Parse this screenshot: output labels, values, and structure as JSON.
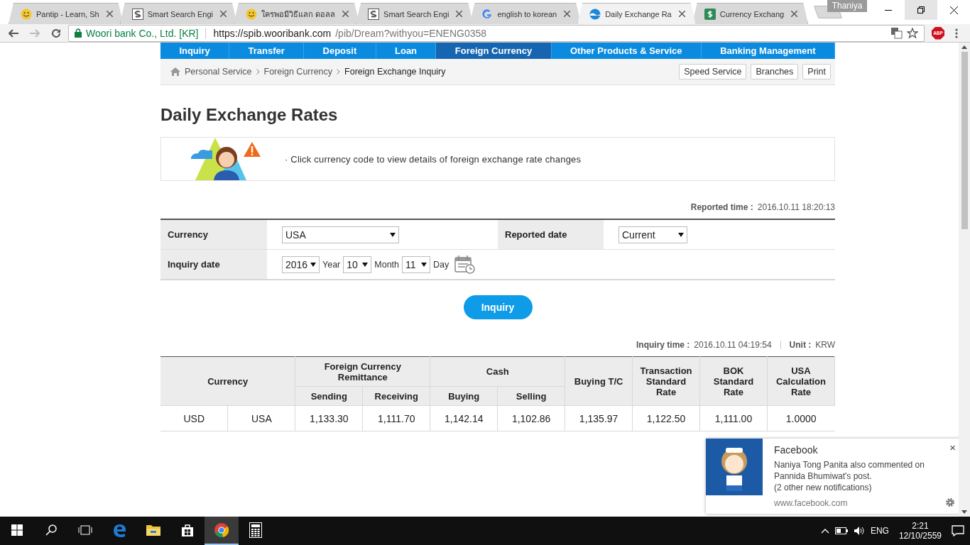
{
  "browser": {
    "tabs": [
      {
        "title": "Pantip - Learn, Sh",
        "kind": "smiley",
        "selected": false
      },
      {
        "title": "Smart Search Engi",
        "kind": "s-logo",
        "selected": false
      },
      {
        "title": "ใครพอมีวิธีแลก ดอลล",
        "kind": "smiley",
        "selected": false
      },
      {
        "title": "Smart Search Engi",
        "kind": "s-logo",
        "selected": false
      },
      {
        "title": "english to korean",
        "kind": "google",
        "selected": false
      },
      {
        "title": "Daily Exchange Ra",
        "kind": "wave",
        "selected": true
      },
      {
        "title": "Currency Exchang",
        "kind": "dollar",
        "selected": false
      }
    ],
    "profile": "Thaniya",
    "site_identity": "Woori bank Co., Ltd. [KR]",
    "url_host": "https://spib.wooribank.com",
    "url_path": "/pib/Dream?withyou=ENENG0358",
    "extension_badge": "ABP"
  },
  "nav_menu": [
    {
      "label": "Inquiry",
      "selected": false
    },
    {
      "label": "Transfer",
      "selected": false
    },
    {
      "label": "Deposit",
      "selected": false
    },
    {
      "label": "Loan",
      "selected": false
    },
    {
      "label": "Foreign Currency",
      "selected": true
    },
    {
      "label": "Other Products & Service",
      "selected": false
    },
    {
      "label": "Banking Management",
      "selected": false
    }
  ],
  "breadcrumb": [
    "Personal Service",
    "Foreign Currency",
    "Foreign Exchange Inquiry"
  ],
  "utility_buttons": [
    "Speed Service",
    "Branches",
    "Print"
  ],
  "page_title": "Daily Exchange Rates",
  "notice": "· Click currency code to view details of foreign exchange rate changes",
  "reported_time": {
    "label": "Reported time :",
    "value": "2016.10.11 18:20:13"
  },
  "form": {
    "currency_label": "Currency",
    "currency_value": "USA",
    "reported_date_label": "Reported date",
    "reported_date_value": "Current",
    "inquiry_date_label": "Inquiry date",
    "year": "2016",
    "year_label": "Year",
    "month": "10",
    "month_label": "Month",
    "day": "11",
    "day_label": "Day"
  },
  "inquiry_button": "Inquiry",
  "inquiry_time": {
    "label": "Inquiry time :",
    "value": "2016.10.11 04:19:54",
    "unit_label": "Unit :",
    "unit_value": "KRW"
  },
  "table": {
    "header_groups": [
      {
        "label": "Currency",
        "kind": "pair"
      },
      {
        "label": "Foreign Currency Remittance",
        "kind": "group",
        "children": [
          "Sending",
          "Receiving"
        ]
      },
      {
        "label": "Cash",
        "kind": "group",
        "children": [
          "Buying",
          "Selling"
        ]
      },
      {
        "label": "Buying T/C",
        "kind": "single"
      },
      {
        "label": "Transaction Standard Rate",
        "kind": "single"
      },
      {
        "label": "BOK Standard Rate",
        "kind": "single"
      },
      {
        "label": "USA Calculation Rate",
        "kind": "single"
      }
    ],
    "rows": [
      [
        "USD",
        "USA",
        "1,133.30",
        "1,111.70",
        "1,142.14",
        "1,102.86",
        "1,135.97",
        "1,122.50",
        "1,111.00",
        "1.0000"
      ]
    ]
  },
  "notification": {
    "title": "Facebook",
    "message": "Naniya Tong Panita also commented on Pannida Bhumiwat's post.",
    "extra": "(2 other new notifications)",
    "source": "www.facebook.com",
    "close": "×"
  },
  "taskbar": {
    "apps": [
      {
        "kind": "edge",
        "active": false
      },
      {
        "kind": "explorer",
        "active": false
      },
      {
        "kind": "store",
        "active": false
      },
      {
        "kind": "chrome",
        "active": true
      },
      {
        "kind": "calculator",
        "active": false
      }
    ],
    "language": "ENG",
    "time": "2:21",
    "date": "12/10/2559"
  }
}
